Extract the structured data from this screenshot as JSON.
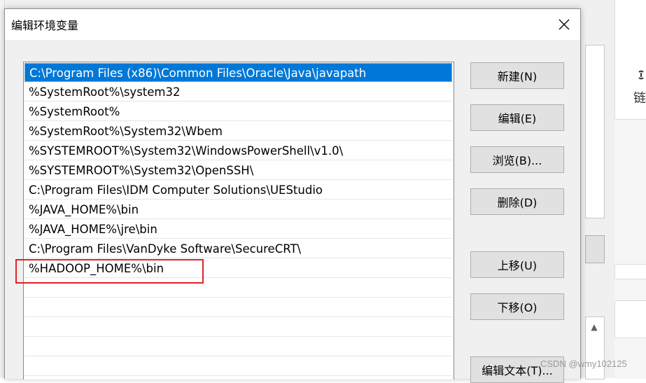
{
  "dialog": {
    "title": "编辑环境变量"
  },
  "paths": [
    "C:\\Program Files (x86)\\Common Files\\Oracle\\Java\\javapath",
    "%SystemRoot%\\system32",
    "%SystemRoot%",
    "%SystemRoot%\\System32\\Wbem",
    "%SYSTEMROOT%\\System32\\WindowsPowerShell\\v1.0\\",
    "%SYSTEMROOT%\\System32\\OpenSSH\\",
    "C:\\Program Files\\IDM Computer Solutions\\UEStudio",
    "%JAVA_HOME%\\bin",
    "%JAVA_HOME%\\jre\\bin",
    "C:\\Program Files\\VanDyke Software\\SecureCRT\\",
    "%HADOOP_HOME%\\bin"
  ],
  "selected_index": 0,
  "buttons": {
    "new": "新建(N)",
    "edit": "编辑(E)",
    "browse": "浏览(B)...",
    "delete": "删除(D)",
    "move_up": "上移(U)",
    "move_down": "下移(O)",
    "edit_text": "编辑文本(T)..."
  },
  "background": {
    "right_char": "链"
  },
  "watermark": "CSDN @wmy102125",
  "colors": {
    "selection": "#0078d7",
    "highlight_box": "#e0222a"
  }
}
